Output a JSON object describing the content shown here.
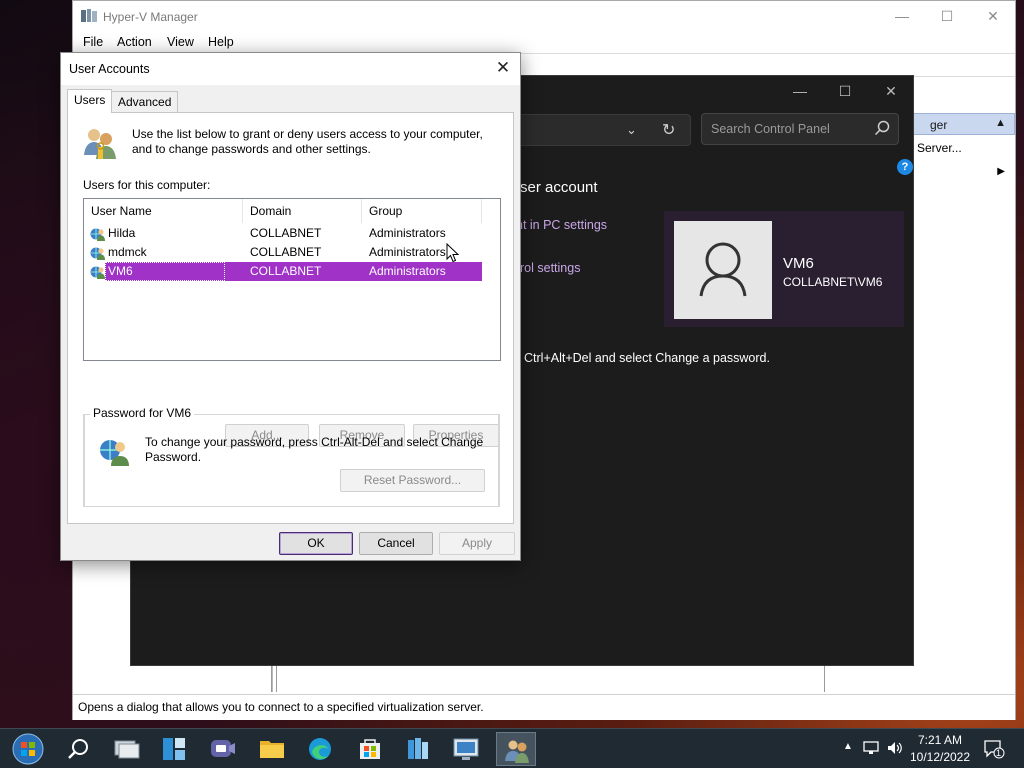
{
  "hyperv": {
    "title": "Hyper-V Manager",
    "menu": [
      "File",
      "Action",
      "View",
      "Help"
    ],
    "window_controls": {
      "minimize": "—",
      "maximize": "☐",
      "close": "✕"
    },
    "actions_header": "ger",
    "actions_items": [
      "Server..."
    ],
    "status_text": "Opens a dialog that allows you to connect to a specified virtualization server."
  },
  "control_panel": {
    "window_controls": {
      "minimize": "—",
      "maximize": "☐",
      "close": "✕"
    },
    "search_placeholder": "Search Control Panel",
    "heading": "ser account",
    "links": [
      "nt in PC settings",
      "rol settings"
    ],
    "user_name": "VM6",
    "user_domain": "COLLABNET\\VM6",
    "password_text": "Ctrl+Alt+Del and select Change a password.",
    "help": "?",
    "colors": {
      "link": "#c9a7e8",
      "card": "#2a1f30"
    }
  },
  "dialog": {
    "title": "User Accounts",
    "close": "✕",
    "tabs": [
      {
        "label": "Users",
        "active": true
      },
      {
        "label": "Advanced",
        "active": false
      }
    ],
    "intro": "Use the list below to grant or deny users access to your computer, and to change passwords and other settings.",
    "list_label": "Users for this computer:",
    "columns": [
      "User Name",
      "Domain",
      "Group"
    ],
    "users": [
      {
        "name": "Hilda",
        "domain": "COLLABNET",
        "group": "Administrators",
        "selected": false
      },
      {
        "name": "mdmck",
        "domain": "COLLABNET",
        "group": "Administrators",
        "selected": false
      },
      {
        "name": "VM6",
        "domain": "COLLABNET",
        "group": "Administrators",
        "selected": true
      }
    ],
    "buttons": {
      "add": "Add...",
      "remove": "Remove",
      "properties": "Properties",
      "reset_password": "Reset Password...",
      "ok": "OK",
      "cancel": "Cancel",
      "apply": "Apply"
    },
    "password_group_label": "Password for VM6",
    "password_text": "To change your password, press Ctrl-Alt-Del and select Change Password.",
    "colors": {
      "selection": "#a032c8"
    }
  },
  "taskbar": {
    "apps": [
      "start-orb",
      "search",
      "task-view",
      "widgets",
      "teams-chat",
      "file-explorer",
      "edge",
      "store",
      "hyper-v-manager",
      "remote-desktop",
      "user-accounts"
    ],
    "active_app": "user-accounts",
    "time": "7:21 AM",
    "date": "10/12/2022",
    "notification_count": "1"
  }
}
